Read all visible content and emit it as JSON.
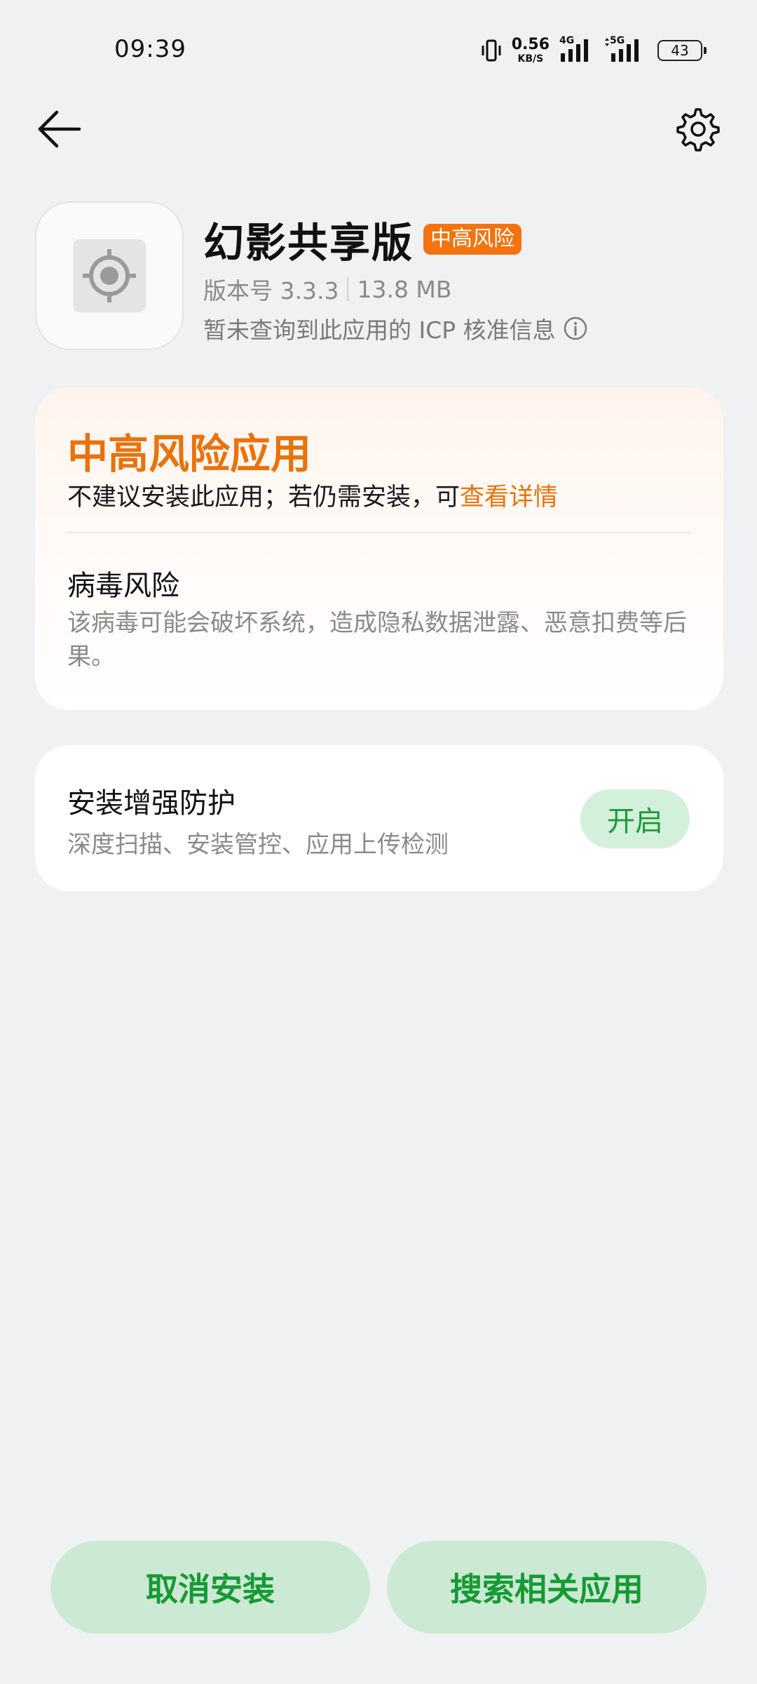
{
  "status_bar": {
    "time": "09:39",
    "net_speed_value": "0.56",
    "net_speed_unit": "KB/S",
    "signal1_type": "4G",
    "signal2_type": "5G",
    "battery_level": "43"
  },
  "icons": {
    "back": "arrow-left-icon",
    "settings": "gear-icon",
    "app": "crosshair-target-icon",
    "info": "info-circle-icon"
  },
  "app": {
    "name": "幻影共享版",
    "risk_badge": "中高风险",
    "version_label": "版本号 3.3.3",
    "size_label": "13.8 MB",
    "icp_text": "暂未查询到此应用的 ICP 核准信息"
  },
  "risk_card": {
    "title": "中高风险应用",
    "desc_prefix": "不建议安装此应用；若仍需安装，可",
    "desc_link": "查看详情",
    "virus_title": "病毒风险",
    "virus_desc": "该病毒可能会破坏系统，造成隐私数据泄露、恶意扣费等后果。"
  },
  "protect_card": {
    "title": "安装增强防护",
    "desc": "深度扫描、安装管控、应用上传检测",
    "button": "开启"
  },
  "actions": {
    "cancel": "取消安装",
    "search": "搜索相关应用"
  },
  "colors": {
    "accent_orange": "#e8730c",
    "badge_orange": "#f4730e",
    "accent_green": "#159a35",
    "button_green_bg": "#cce9d3",
    "background": "#f0f1f3"
  }
}
